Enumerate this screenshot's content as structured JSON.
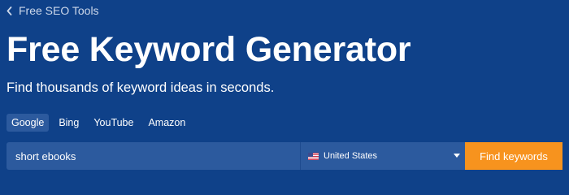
{
  "breadcrumb": {
    "back_label": "Free SEO Tools",
    "icon": "chevron-left-icon"
  },
  "header": {
    "title": "Free Keyword Generator",
    "subtitle": "Find thousands of keyword ideas in seconds."
  },
  "engine_tabs": {
    "items": [
      {
        "label": "Google",
        "active": true
      },
      {
        "label": "Bing",
        "active": false
      },
      {
        "label": "YouTube",
        "active": false
      },
      {
        "label": "Amazon",
        "active": false
      }
    ]
  },
  "search": {
    "value": "short ebooks",
    "country": {
      "label": "United States",
      "flag": "us-flag-icon"
    },
    "button_label": "Find keywords"
  },
  "colors": {
    "background": "#0f4189",
    "field": "#2c5a9e",
    "accent": "#f7931e"
  }
}
